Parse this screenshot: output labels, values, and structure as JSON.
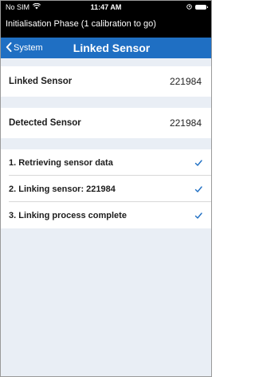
{
  "status_bar": {
    "carrier": "No SIM",
    "time": "11:47 AM"
  },
  "phase_banner": "Initialisation Phase (1 calibration to go)",
  "nav": {
    "back_label": "System",
    "title": "Linked Sensor"
  },
  "sensor_rows": [
    {
      "label": "Linked Sensor",
      "value": "221984"
    },
    {
      "label": "Detected Sensor",
      "value": "221984"
    }
  ],
  "steps": [
    {
      "label": "1. Retrieving sensor data",
      "done": true
    },
    {
      "label": "2. Linking sensor: 221984",
      "done": true
    },
    {
      "label": "3. Linking process complete",
      "done": true
    }
  ],
  "colors": {
    "nav_bar": "#1f6fc3",
    "check": "#1f6fc3",
    "background": "#e9eef5"
  }
}
